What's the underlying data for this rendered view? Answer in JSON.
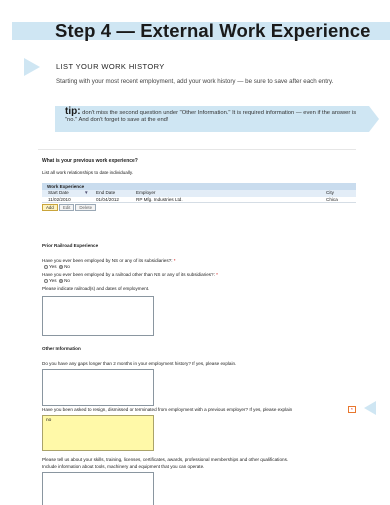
{
  "header": {
    "title": "Step 4 — External Work Experience"
  },
  "section": {
    "heading": "LIST YOUR WORK HISTORY",
    "intro": "Starting with your most recent employment, add your work history — be sure to save after each entry."
  },
  "tip": {
    "label": "tip:",
    "text": "don't miss the second question under \"Other Information.\" It is required information — even if the answer is \"no.\" And don't forget to save at the end!"
  },
  "form": {
    "heading": "What is your previous work experience?",
    "subtext": "List all work relationships to date individually.",
    "work_table": {
      "title": "Work Experience",
      "columns": [
        "Start Date",
        "▼",
        "End Date",
        "Employer",
        "City"
      ],
      "rows": [
        {
          "start": "11/02/2010",
          "end": "01/04/2012",
          "employer": "RP Mfg. Industries Ltd.",
          "city": "Chica"
        }
      ]
    },
    "buttons": {
      "add": "Add",
      "edit": "Edit",
      "delete": "Delete"
    },
    "railroad": {
      "heading": "Prior Railroad Experience",
      "q1": "Have you ever been employed by NS or any of its subsidiaries?:",
      "q1_yes": "Yes",
      "q1_no": "No",
      "q2": "Have you ever been employed by a railroad other than NS or any of its subsidiaries?:",
      "q2_yes": "Yes",
      "q2_no": "No",
      "q3": "Please indicate railroad(s) and dates of employment."
    },
    "other": {
      "heading": "Other Information",
      "q_gaps": "Do you have any gaps longer than 2 months in your employment history? If yes, please explain.",
      "q_resign": "Have you been asked to resign, dismissed or terminated from employment with a previous employer? If yes, please explain",
      "resign_answer": "no",
      "q_skills_1": "Please tell us about your skills, training, licenses, certificates, awards, professional memberships and other qualifications.",
      "q_skills_2": "Include information about tools, machinery and equipment that you can operate."
    },
    "required_marker": "*"
  }
}
